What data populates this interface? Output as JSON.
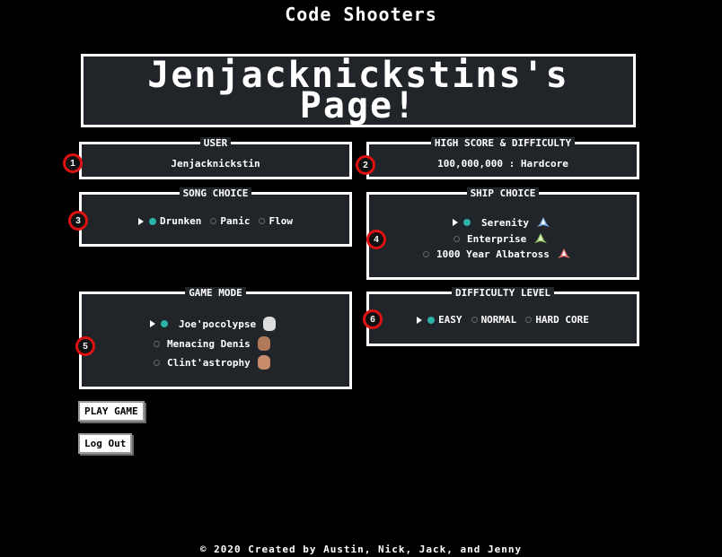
{
  "site_title": "Code Shooters",
  "hero_title": "Jenjacknickstins's\nPage!",
  "user": {
    "title": "USER",
    "name": "Jenjacknickstin"
  },
  "high_score": {
    "title": "HIGH SCORE & DIFFICULTY",
    "value": "100,000,000 : Hardcore"
  },
  "song_choice": {
    "title": "SONG CHOICE",
    "options": [
      "Drunken",
      "Panic",
      "Flow"
    ],
    "selected": 0
  },
  "ship_choice": {
    "title": "SHIP CHOICE",
    "options": [
      "Serenity",
      "Enterprise",
      "1000 Year Albatross"
    ],
    "selected": 0
  },
  "game_mode": {
    "title": "GAME MODE",
    "options": [
      "Joe'pocolypse",
      "Menacing Denis",
      "Clint'astrophy"
    ],
    "selected": 0
  },
  "difficulty": {
    "title": "DIFFICULTY LEVEL",
    "options": [
      "EASY",
      "NORMAL",
      "HARD CORE"
    ],
    "selected": 0
  },
  "markers": [
    "1",
    "2",
    "3",
    "4",
    "5",
    "6"
  ],
  "buttons": {
    "play": "PLAY GAME",
    "logout": "Log Out"
  },
  "footer": "© 2020 Created by Austin, Nick, Jack, and Jenny",
  "colors": {
    "panel": "#212529",
    "accent": "#2ab3a6",
    "marker": "#dd1111"
  }
}
